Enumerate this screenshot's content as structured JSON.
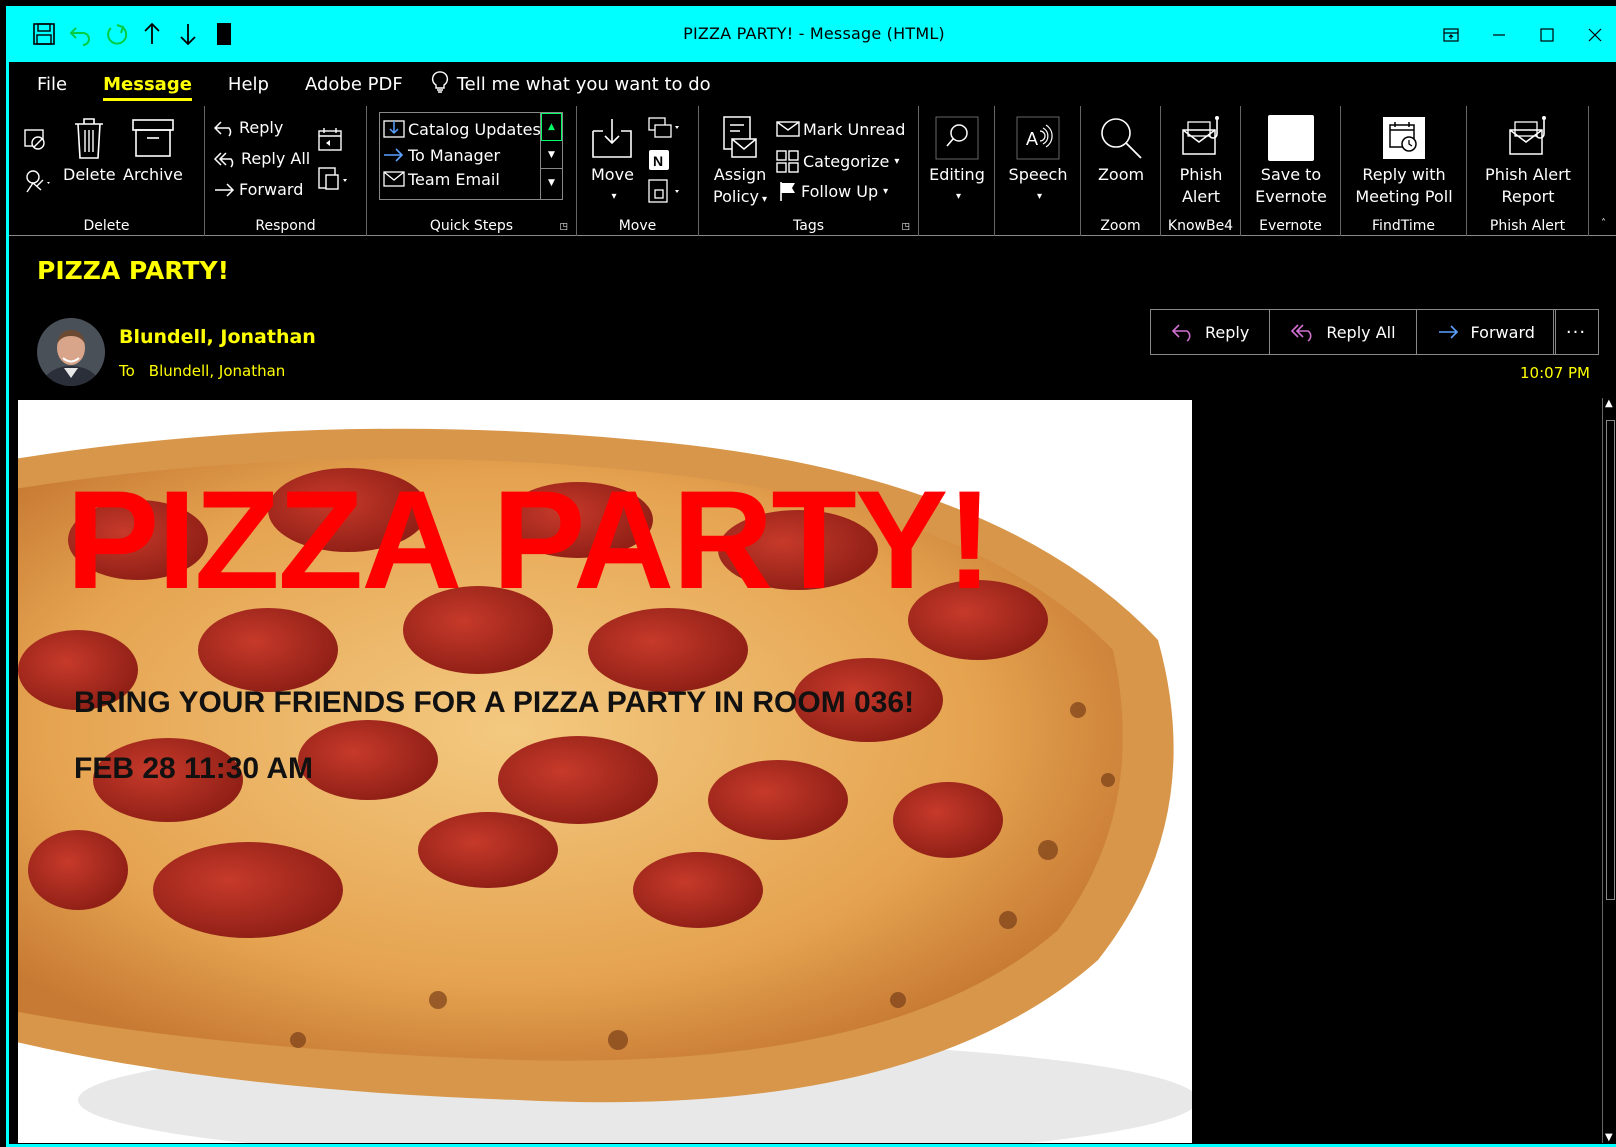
{
  "window": {
    "title": "PIZZA PARTY!  -  Message (HTML)",
    "accent_color": "#00ffff",
    "highlight_color": "#ffff00"
  },
  "quick_access": [
    "save-icon",
    "undo-icon",
    "redo-icon",
    "up-arrow-icon",
    "down-arrow-icon",
    "customize-icon"
  ],
  "menu": {
    "tabs": [
      "File",
      "Message",
      "Help",
      "Adobe PDF"
    ],
    "active_tab": "Message",
    "tell_me": "Tell me what you want to do"
  },
  "ribbon": {
    "delete_group": {
      "label": "Delete",
      "delete": "Delete",
      "archive": "Archive"
    },
    "respond_group": {
      "label": "Respond",
      "reply": "Reply",
      "reply_all": "Reply All",
      "forward": "Forward"
    },
    "quick_steps": {
      "label": "Quick Steps",
      "items": [
        "Catalog Updates",
        "To Manager",
        "Team Email"
      ]
    },
    "move_group": {
      "label": "Move",
      "move": "Move"
    },
    "tags_group": {
      "label": "Tags",
      "assign_policy_1": "Assign",
      "assign_policy_2": "Policy",
      "mark_unread": "Mark Unread",
      "categorize": "Categorize",
      "follow_up": "Follow Up"
    },
    "editing": "Editing",
    "speech": "Speech",
    "zoom_group": {
      "label": "Zoom",
      "zoom": "Zoom"
    },
    "knowbe4": {
      "label": "KnowBe4",
      "line1": "Phish",
      "line2": "Alert"
    },
    "evernote": {
      "label": "Evernote",
      "line1": "Save to",
      "line2": "Evernote"
    },
    "findtime": {
      "label": "FindTime",
      "line1": "Reply with",
      "line2": "Meeting Poll"
    },
    "phish_alert": {
      "label": "Phish Alert",
      "line1": "Phish Alert",
      "line2": "Report"
    }
  },
  "message": {
    "subject": "PIZZA PARTY!",
    "sender": "Blundell, Jonathan",
    "to_label": "To",
    "to": "Blundell, Jonathan",
    "time": "10:07 PM",
    "actions": {
      "reply": "Reply",
      "reply_all": "Reply All",
      "forward": "Forward",
      "more": "···"
    },
    "body": {
      "headline": "PIZZA PARTY!",
      "line1": "BRING YOUR FRIENDS FOR A PIZZA PARTY IN ROOM 036!",
      "line2": "FEB 28 11:30 AM"
    }
  }
}
